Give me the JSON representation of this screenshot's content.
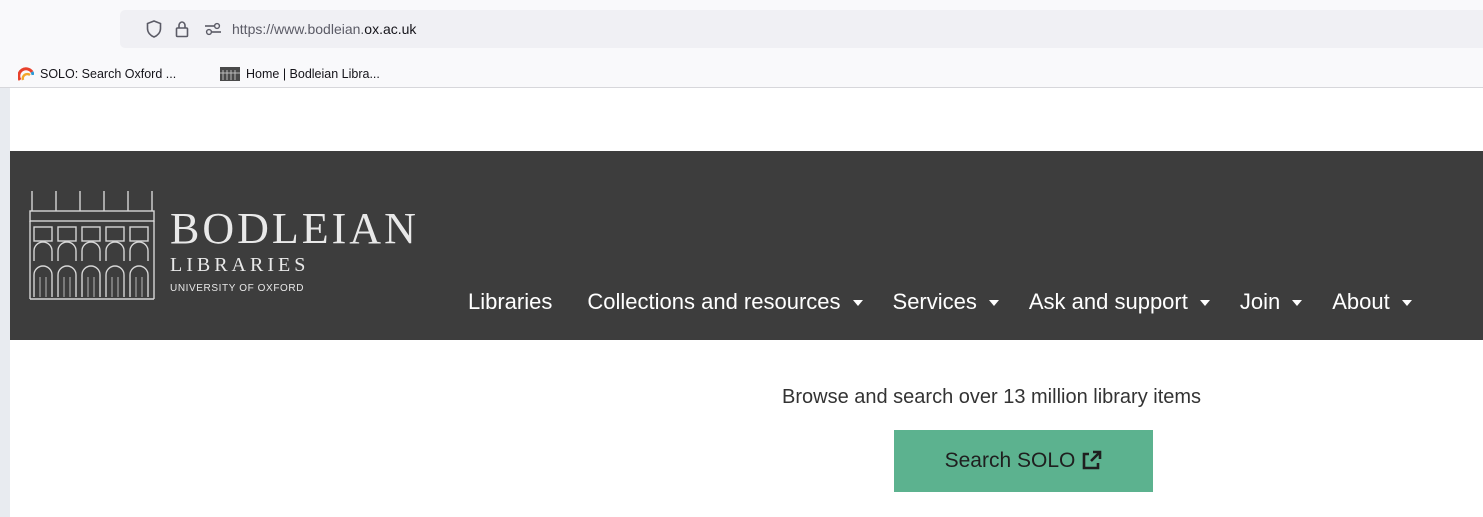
{
  "browser": {
    "url_prefix": "https://www.bodleian.",
    "url_domain": "ox.ac.uk",
    "bookmarks": [
      {
        "label": "SOLO: Search Oxford ...",
        "icon": "solo-rainbow-icon"
      },
      {
        "label": "Home | Bodleian Libra...",
        "icon": "bodleian-favicon"
      }
    ],
    "icons": [
      "shield-icon",
      "lock-icon",
      "permissions-icon"
    ]
  },
  "header": {
    "logo": {
      "title": "BODLEIAN",
      "subtitle": "LIBRARIES",
      "university": "UNIVERSITY OF OXFORD"
    },
    "nav": [
      {
        "label": "Libraries",
        "has_dropdown": false
      },
      {
        "label": "Collections and resources",
        "has_dropdown": true
      },
      {
        "label": "Services",
        "has_dropdown": true
      },
      {
        "label": "Ask and support",
        "has_dropdown": true
      },
      {
        "label": "Join",
        "has_dropdown": true
      },
      {
        "label": "About",
        "has_dropdown": true
      }
    ]
  },
  "main": {
    "tagline": "Browse and search over 13 million library items",
    "search_button": "Search SOLO",
    "search_button_icon": "external-link-icon"
  },
  "colors": {
    "header_bg": "#3d3d3d",
    "button_bg": "#5cb28f",
    "page_bg": "#ffffff"
  }
}
